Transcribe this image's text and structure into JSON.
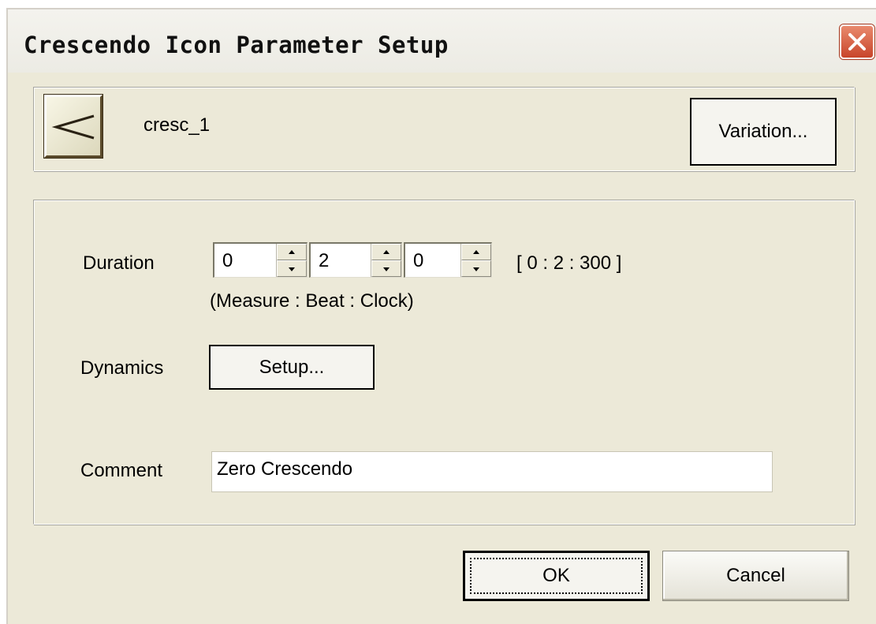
{
  "window": {
    "title": "Crescendo Icon Parameter Setup"
  },
  "icon": {
    "name": "cresc_1",
    "symbol": "crescendo-icon"
  },
  "buttons": {
    "variation": "Variation...",
    "setup": "Setup...",
    "ok": "OK",
    "cancel": "Cancel"
  },
  "duration": {
    "label": "Duration",
    "measure": "0",
    "beat": "2",
    "clock": "0",
    "units": "(Measure : Beat : Clock)",
    "total": "[ 0 : 2 : 300 ]"
  },
  "dynamics": {
    "label": "Dynamics"
  },
  "comment": {
    "label": "Comment",
    "value": "Zero Crescendo"
  },
  "colors": {
    "dialog_bg": "#ece9d8",
    "close_button": "#c8452a"
  }
}
